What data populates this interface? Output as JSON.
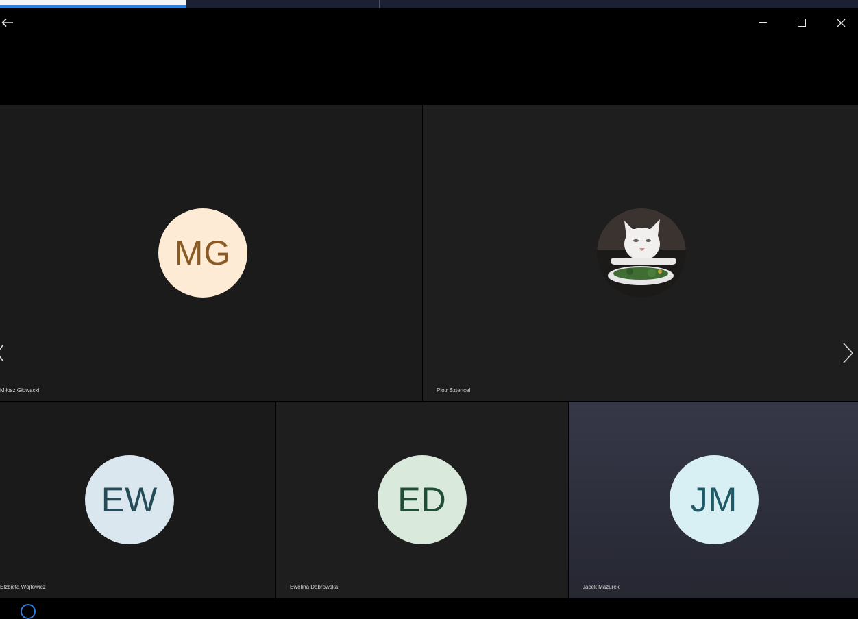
{
  "window": {
    "back_icon": "arrow-left-icon",
    "minimize_icon": "minimize-icon",
    "maximize_icon": "maximize-icon",
    "close_icon": "close-icon"
  },
  "participants": [
    {
      "initials": "MG",
      "name": "Miłosz Głowacki",
      "avatar_bg": "#fdebd5",
      "initials_color": "#8a5a25"
    },
    {
      "initials": "",
      "name": "Piotr Sztencel",
      "avatar_type": "photo"
    },
    {
      "initials": "EW",
      "name": "Elżbieta Wójtowicz",
      "avatar_bg": "#dbe7ee",
      "initials_color": "#244b57"
    },
    {
      "initials": "ED",
      "name": "Ewelina  Dąbrowska",
      "avatar_bg": "#d9e9dc",
      "initials_color": "#1f4d35"
    },
    {
      "initials": "JM",
      "name": "Jacek Mazurek",
      "avatar_bg": "#d8f0f3",
      "initials_color": "#1f5a66"
    }
  ],
  "nav": {
    "prev_icon": "chevron-left-icon",
    "next_icon": "chevron-right-icon"
  }
}
